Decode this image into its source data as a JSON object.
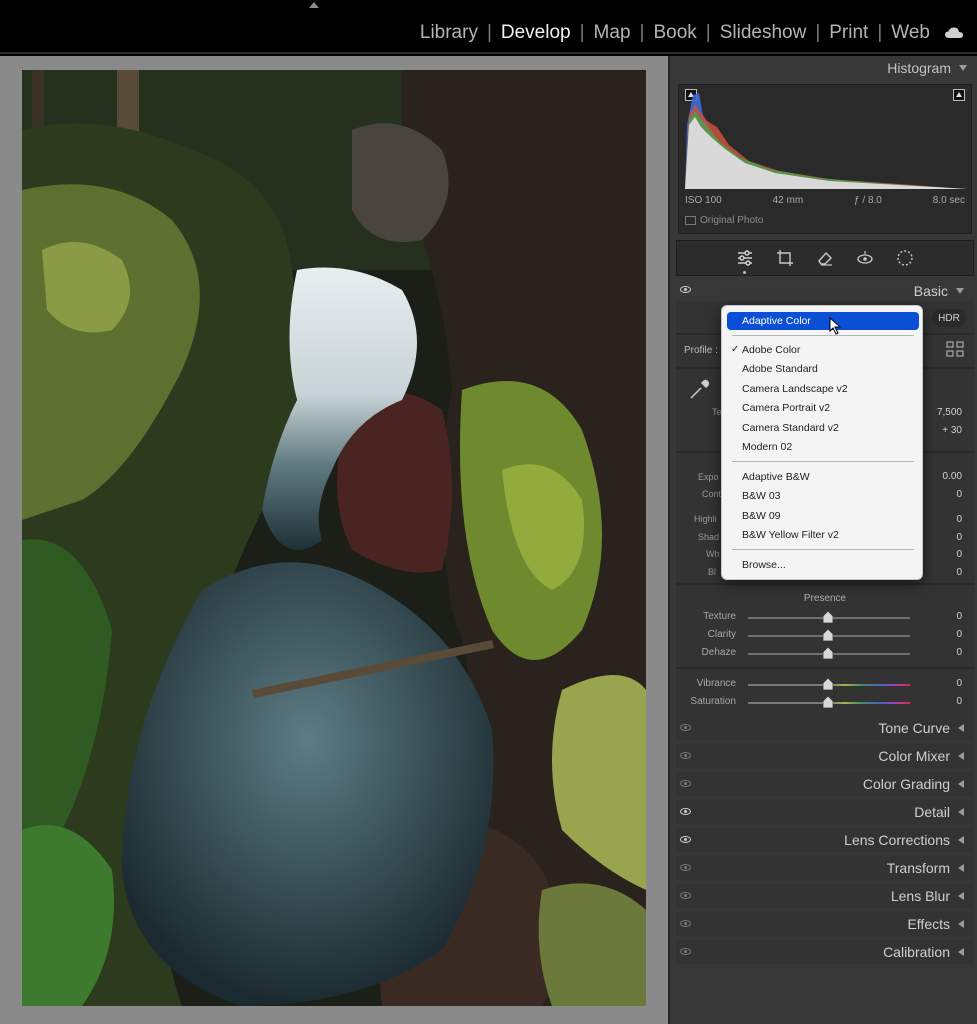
{
  "modules": {
    "items": [
      "Library",
      "Develop",
      "Map",
      "Book",
      "Slideshow",
      "Print",
      "Web"
    ],
    "active": "Develop"
  },
  "histogram": {
    "title": "Histogram",
    "iso": "ISO 100",
    "focal": "42 mm",
    "aperture": "ƒ / 8.0",
    "shutter": "8.0 sec",
    "original_photo": "Original Photo"
  },
  "basic": {
    "title": "Basic",
    "hdr": "HDR",
    "profile_label": "Profile :",
    "temp_value": "7,500",
    "tint_value": "+ 30",
    "exposure_value": "0.00",
    "contrast_value": "0",
    "highlights_value": "0",
    "shadows_value": "0",
    "whites_value": "0",
    "blacks_value": "0",
    "row_fragments": [
      "Te",
      "Expo",
      "Cont",
      "Highli",
      "Shad",
      "Wh",
      "Bl"
    ]
  },
  "presence": {
    "title": "Presence",
    "sliders": [
      {
        "label": "Texture",
        "value": "0"
      },
      {
        "label": "Clarity",
        "value": "0"
      },
      {
        "label": "Dehaze",
        "value": "0"
      },
      {
        "label": "Vibrance",
        "value": "0"
      },
      {
        "label": "Saturation",
        "value": "0"
      }
    ]
  },
  "sections": [
    {
      "label": "Tone Curve",
      "eye": "off"
    },
    {
      "label": "Color Mixer",
      "eye": "off"
    },
    {
      "label": "Color Grading",
      "eye": "off"
    },
    {
      "label": "Detail",
      "eye": "on"
    },
    {
      "label": "Lens Corrections",
      "eye": "on"
    },
    {
      "label": "Transform",
      "eye": "off"
    },
    {
      "label": "Lens Blur",
      "eye": "off"
    },
    {
      "label": "Effects",
      "eye": "off"
    },
    {
      "label": "Calibration",
      "eye": "off"
    }
  ],
  "profile_menu": {
    "highlighted": "Adaptive Color",
    "checked": "Adobe Color",
    "group1": [
      "Adobe Color",
      "Adobe Standard",
      "Camera Landscape v2",
      "Camera Portrait v2",
      "Camera Standard v2",
      "Modern 02"
    ],
    "group2": [
      "Adaptive B&W",
      "B&W 03",
      "B&W 09",
      "B&W Yellow Filter v2"
    ],
    "browse": "Browse..."
  },
  "colors": {
    "highlight": "#0a4fd6",
    "panel": "#383838",
    "background": "#8a8a8a"
  }
}
